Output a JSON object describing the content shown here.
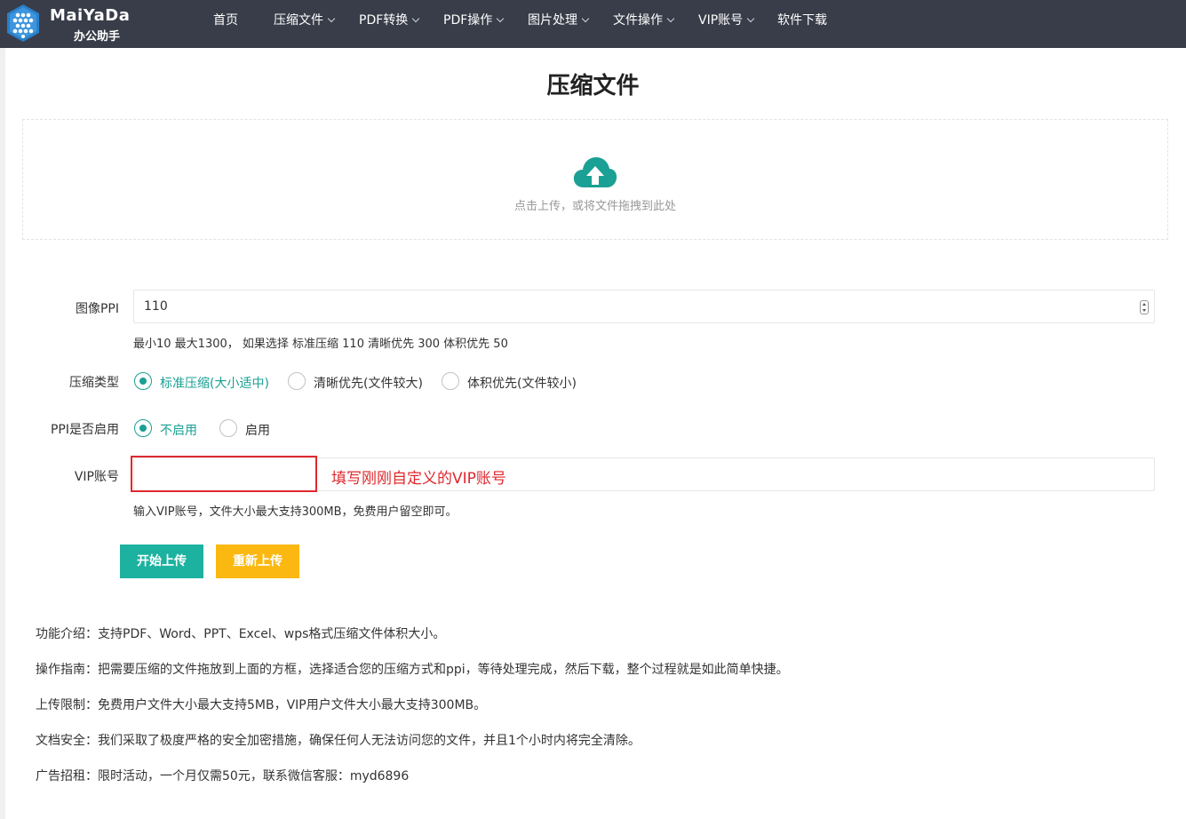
{
  "header": {
    "logo_name": "MaiYaDa",
    "logo_sub": "办公助手",
    "nav": [
      {
        "label": "首页",
        "dropdown": false
      },
      {
        "label": "压缩文件",
        "dropdown": true
      },
      {
        "label": "PDF转换",
        "dropdown": true
      },
      {
        "label": "PDF操作",
        "dropdown": true
      },
      {
        "label": "图片处理",
        "dropdown": true
      },
      {
        "label": "文件操作",
        "dropdown": true
      },
      {
        "label": "VIP账号",
        "dropdown": true
      },
      {
        "label": "软件下载",
        "dropdown": false
      }
    ],
    "bg_color": "#393d49"
  },
  "page_title": "压缩文件",
  "upload": {
    "icon": "cloud-upload-icon",
    "text": "点击上传，或将文件拖拽到此处",
    "icon_color": "#1aa094"
  },
  "form": {
    "ppi": {
      "label": "图像PPI",
      "value": "110",
      "hint": "最小10 最大1300， 如果选择 标准压缩 110 清晰优先 300 体积优先 50"
    },
    "compress_type": {
      "label": "压缩类型",
      "options": [
        "标准压缩(大小适中)",
        "清晰优先(文件较大)",
        "体积优先(文件较小)"
      ],
      "selected": "标准压缩(大小适中)"
    },
    "ppi_enable": {
      "label": "PPI是否启用",
      "options": [
        "不启用",
        "启用"
      ],
      "selected": "不启用"
    },
    "vip": {
      "label": "VIP账号",
      "value": "",
      "annotation": "填写刚刚自定义的VIP账号",
      "hint": "输入VIP账号，文件大小最大支持300MB，免费用户留空即可。"
    },
    "buttons": {
      "start": "开始上传",
      "reset": "重新上传"
    }
  },
  "info": [
    "功能介绍：支持PDF、Word、PPT、Excel、wps格式压缩文件体积大小。",
    "操作指南：把需要压缩的文件拖放到上面的方框，选择适合您的压缩方式和ppi，等待处理完成，然后下载，整个过程就是如此简单快捷。",
    "上传限制：免费用户文件大小最大支持5MB，VIP用户文件大小最大支持300MB。",
    "文档安全：我们采取了极度严格的安全加密措施，确保任何人无法访问您的文件，并且1个小时内将完全清除。",
    "广告招租：限时活动，一个月仅需50元，联系微信客服：myd6896"
  ],
  "colors": {
    "primary": "#1cb29f",
    "warning": "#fbb810",
    "annotation": "#e0282d"
  }
}
